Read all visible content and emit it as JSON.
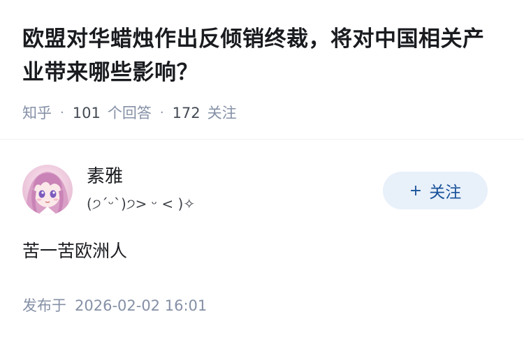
{
  "question": {
    "title": "欧盟对华蜡烛作出反倾销终裁，将对中国相关产业带来哪些影响？",
    "source": "知乎",
    "answers_count": "101",
    "answers_label": "个回答",
    "followers_count": "172",
    "followers_label": "关注"
  },
  "author": {
    "name": "素雅",
    "bio": "(੭ˊᵕˋ)੭> ᵕ < )✧",
    "avatar_icon": "anime-girl-avatar",
    "follow_label": "关注",
    "follow_icon": "plus-icon"
  },
  "answer": {
    "content": "苦一苦欧洲人",
    "publish_label": "发布于",
    "publish_time": "2026-02-02 16:01"
  },
  "colors": {
    "meta_gray": "#8590a6",
    "follow_bg": "#e8f0fa",
    "follow_text": "#175199"
  }
}
